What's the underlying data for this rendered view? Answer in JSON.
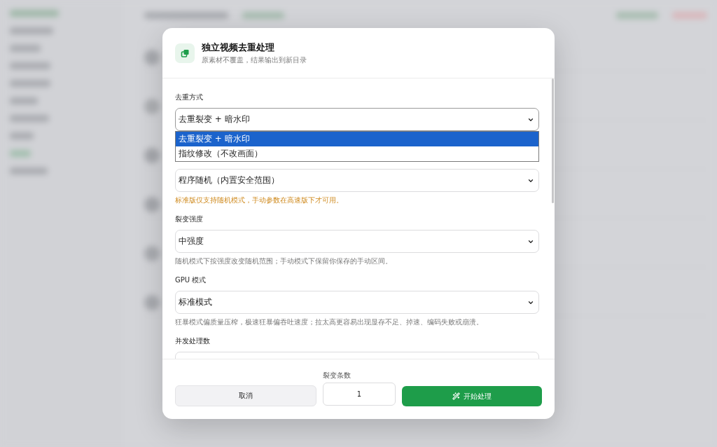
{
  "dialog": {
    "title": "独立视频去重处理",
    "subtitle": "原素材不覆盖，结果输出到新目录",
    "fields": [
      {
        "kind": "select",
        "label": "去重方式",
        "value": "去重裂变 + 暗水印",
        "expanded": true,
        "options": [
          {
            "label": "去重裂变 + 暗水印",
            "selected": true
          },
          {
            "label": "指纹修改（不改画面）",
            "selected": false
          }
        ]
      },
      {
        "kind": "select",
        "value": "程序随机（内置安全范围）",
        "expanded": false,
        "hint": "标准版仅支持随机模式，手动参数在高速版下才可用。",
        "hint_warning": true
      },
      {
        "kind": "select",
        "label": "裂变强度",
        "value": "中强度",
        "expanded": false,
        "hint": "随机模式下按强度改变随机范围；手动模式下保留你保存的手动区间。",
        "hint_warning": false
      },
      {
        "kind": "select",
        "label": "GPU 模式",
        "value": "标准模式",
        "expanded": false,
        "hint": "狂暴模式偏质量压榨，极速狂暴偏吞吐速度；拉太高更容易出现显存不足、掉速、编码失败或崩溃。",
        "hint_warning": false
      },
      {
        "kind": "select",
        "label": "并发处理数",
        "expanded": false
      }
    ],
    "footer": {
      "cancel_button": "取消",
      "count": {
        "label": "裂变条数",
        "value": "1"
      },
      "start_button": "开始处理"
    }
  }
}
